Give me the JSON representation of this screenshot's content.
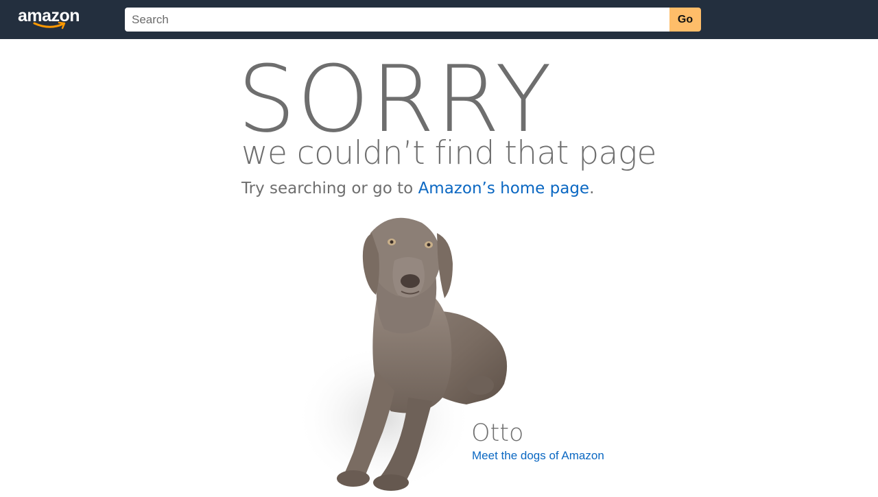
{
  "header": {
    "logo_text": "amazon",
    "search": {
      "placeholder": "Search",
      "value": ""
    },
    "go_label": "Go"
  },
  "main": {
    "headline": "SORRY",
    "subtitle": "we couldn’t find that page",
    "try_prefix": "Try searching or go to ",
    "home_link": "Amazon’s home page",
    "try_suffix": ".",
    "dog": {
      "name": "Otto",
      "link": "Meet the dogs of Amazon"
    }
  },
  "colors": {
    "topbar": "#232f3e",
    "go_button": "#febd69",
    "link": "#0a67c2",
    "text": "#6e6e6e",
    "smile": "#ff9900"
  },
  "icons": [
    "amazon-logo",
    "amazon-smile-arrow-icon",
    "dog-photo"
  ]
}
